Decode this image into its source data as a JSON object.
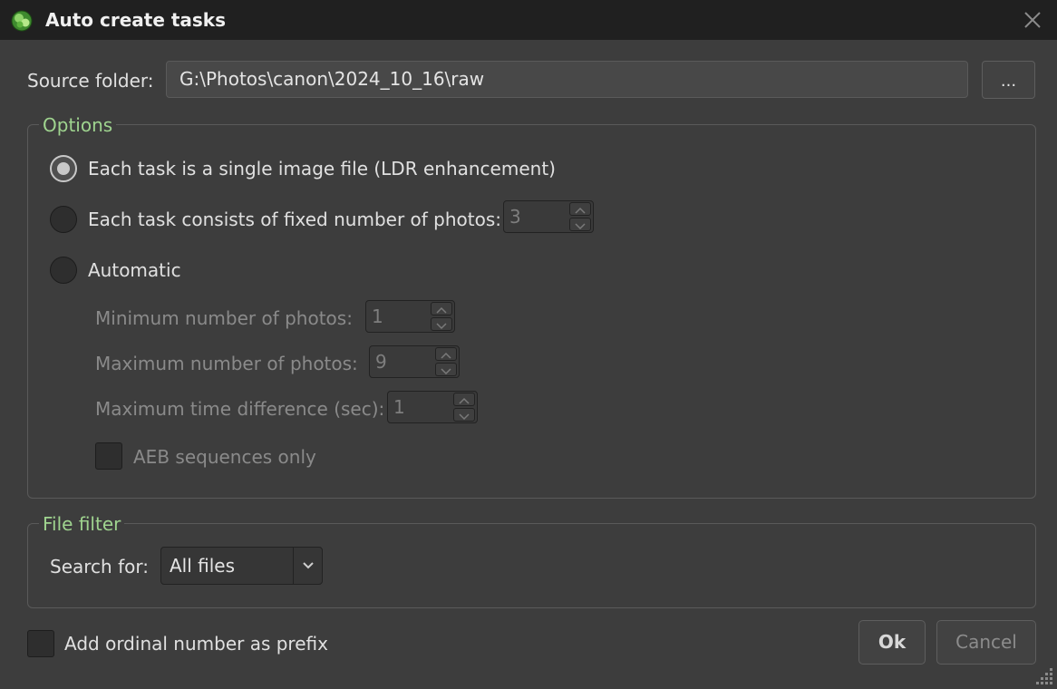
{
  "window": {
    "title": "Auto create tasks"
  },
  "source": {
    "label": "Source folder:",
    "path": "G:\\Photos\\canon\\2024_10_16\\raw",
    "browse_label": "..."
  },
  "options": {
    "legend": "Options",
    "single_image_label": "Each task is a single image file (LDR enhancement)",
    "fixed_number_label": "Each task consists of fixed number of photos:",
    "fixed_number_value": "3",
    "automatic_label": "Automatic",
    "min_photos_label": "Minimum number of photos:",
    "min_photos_value": "1",
    "max_photos_label": "Maximum number of photos:",
    "max_photos_value": "9",
    "max_time_label": "Maximum time difference (sec):",
    "max_time_value": "1",
    "aeb_label": "AEB sequences only",
    "selected": "single_image"
  },
  "file_filter": {
    "legend": "File filter",
    "search_label": "Search for:",
    "search_value": "All files"
  },
  "footer": {
    "ordinal_prefix_label": "Add ordinal number as prefix",
    "ok_label": "Ok",
    "cancel_label": "Cancel"
  },
  "colors": {
    "legend": "#9fd48f",
    "background": "#3d3d3d",
    "titlebar": "#202020"
  },
  "icons": {
    "app": "app-logo-icon",
    "close": "close-icon",
    "dropdown": "chevron-down-icon"
  }
}
